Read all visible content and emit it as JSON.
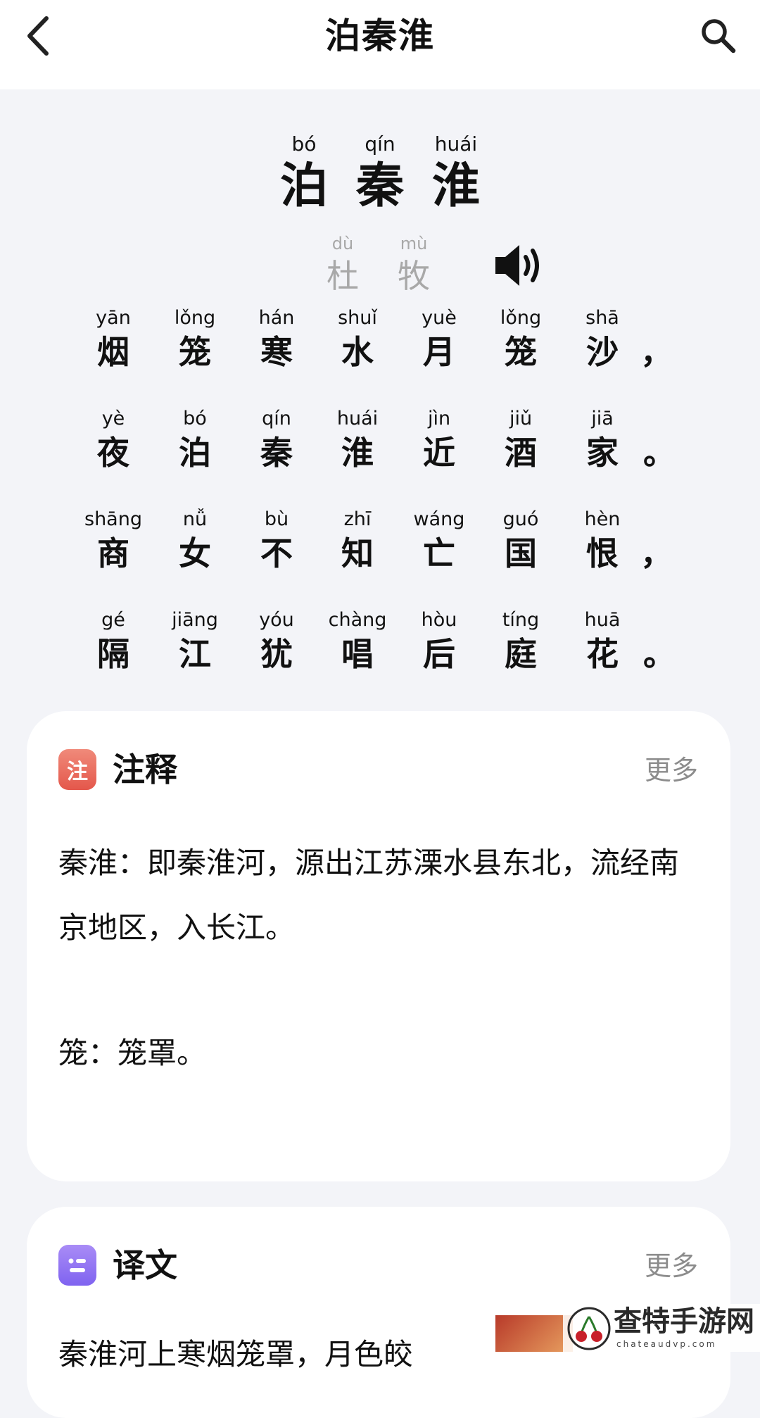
{
  "header": {
    "title": "泊秦淮",
    "back_icon": "chevron-left-icon",
    "search_icon": "search-icon"
  },
  "poem": {
    "title": [
      {
        "pinyin": "bó",
        "char": "泊"
      },
      {
        "pinyin": "qín",
        "char": "秦"
      },
      {
        "pinyin": "huái",
        "char": "淮"
      }
    ],
    "author": [
      {
        "pinyin": "dù",
        "char": "杜"
      },
      {
        "pinyin": "mù",
        "char": "牧"
      }
    ],
    "audio_icon": "speaker-icon",
    "lines": [
      {
        "chars": [
          {
            "pinyin": "yān",
            "char": "烟"
          },
          {
            "pinyin": "lǒng",
            "char": "笼"
          },
          {
            "pinyin": "hán",
            "char": "寒"
          },
          {
            "pinyin": "shuǐ",
            "char": "水"
          },
          {
            "pinyin": "yuè",
            "char": "月"
          },
          {
            "pinyin": "lǒng",
            "char": "笼"
          },
          {
            "pinyin": "shā",
            "char": "沙"
          }
        ],
        "punct": "，"
      },
      {
        "chars": [
          {
            "pinyin": "yè",
            "char": "夜"
          },
          {
            "pinyin": "bó",
            "char": "泊"
          },
          {
            "pinyin": "qín",
            "char": "秦"
          },
          {
            "pinyin": "huái",
            "char": "淮"
          },
          {
            "pinyin": "jìn",
            "char": "近"
          },
          {
            "pinyin": "jiǔ",
            "char": "酒"
          },
          {
            "pinyin": "jiā",
            "char": "家"
          }
        ],
        "punct": "。"
      },
      {
        "chars": [
          {
            "pinyin": "shāng",
            "char": "商"
          },
          {
            "pinyin": "nǚ",
            "char": "女"
          },
          {
            "pinyin": "bù",
            "char": "不"
          },
          {
            "pinyin": "zhī",
            "char": "知"
          },
          {
            "pinyin": "wáng",
            "char": "亡"
          },
          {
            "pinyin": "guó",
            "char": "国"
          },
          {
            "pinyin": "hèn",
            "char": "恨"
          }
        ],
        "punct": "，"
      },
      {
        "chars": [
          {
            "pinyin": "gé",
            "char": "隔"
          },
          {
            "pinyin": "jiāng",
            "char": "江"
          },
          {
            "pinyin": "yóu",
            "char": "犹"
          },
          {
            "pinyin": "chàng",
            "char": "唱"
          },
          {
            "pinyin": "hòu",
            "char": "后"
          },
          {
            "pinyin": "tíng",
            "char": "庭"
          },
          {
            "pinyin": "huā",
            "char": "花"
          }
        ],
        "punct": "。"
      }
    ]
  },
  "notes": {
    "icon_label": "注",
    "title": "注释",
    "more": "更多",
    "paragraphs": [
      "秦淮：即秦淮河，源出江苏溧水县东北，流经南京地区，入长江。",
      "笼：笼罩。"
    ]
  },
  "translation": {
    "title": "译文",
    "more": "更多",
    "text": "秦淮河上寒烟笼罩，月色皎"
  },
  "watermark": {
    "text": "查特手游网",
    "url": "chateaudvp.com"
  },
  "colors": {
    "background": "#f3f4f8",
    "card": "#ffffff",
    "author": "#a8a8a8",
    "more": "#8c8c8c",
    "notes_icon": "#e4574b",
    "translation_icon": "#7f63f0"
  }
}
